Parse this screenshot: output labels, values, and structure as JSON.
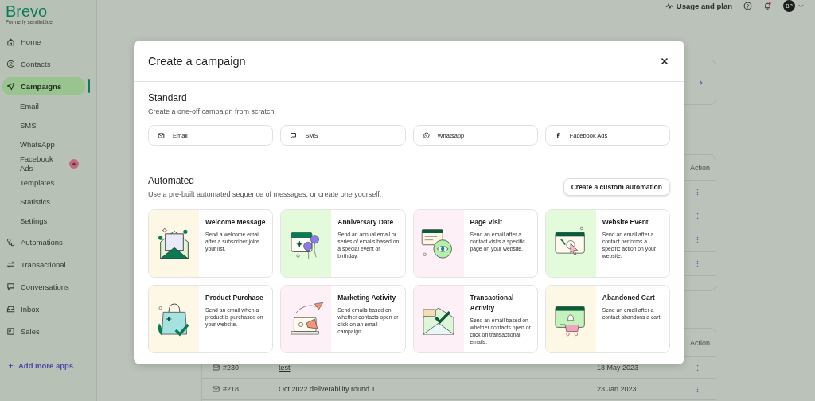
{
  "sidebar": {
    "logo": "Brevo",
    "logo_tagline": "Formerly sendinblue",
    "items": [
      {
        "label": "Home",
        "selected": false
      },
      {
        "label": "Contacts",
        "selected": false
      },
      {
        "label": "Campaigns",
        "selected": true,
        "children": [
          {
            "label": "Email",
            "upgrade_badge": false
          },
          {
            "label": "SMS",
            "upgrade_badge": false
          },
          {
            "label": "WhatsApp",
            "upgrade_badge": false
          },
          {
            "label": "Facebook Ads",
            "upgrade_badge": true
          },
          {
            "label": "Templates",
            "upgrade_badge": false
          },
          {
            "label": "Statistics",
            "upgrade_badge": false
          },
          {
            "label": "Settings",
            "upgrade_badge": false
          }
        ]
      },
      {
        "label": "Automations",
        "selected": false
      },
      {
        "label": "Transactional",
        "selected": false
      },
      {
        "label": "Conversations",
        "selected": false
      },
      {
        "label": "Inbox",
        "selected": false
      },
      {
        "label": "Sales",
        "selected": false
      }
    ],
    "add_apps": "Add more apps"
  },
  "header": {
    "usage_link": "Usage and plan",
    "notification_dot": true,
    "avatar_initials": "BP"
  },
  "tables": [
    {
      "action_header": "Action"
    },
    {
      "action_header": "Action",
      "rows": [
        {
          "id": "#230",
          "name": "test",
          "date": "18 May 2023"
        },
        {
          "id": "#218",
          "name": "Oct 2022 deliverability round 1",
          "date": "23 Jan 2023"
        }
      ]
    }
  ],
  "modal": {
    "title": "Create a campaign",
    "standard": {
      "heading": "Standard",
      "description": "Create a one-off campaign from scratch.",
      "channels": [
        {
          "label": "Email",
          "kind": "email"
        },
        {
          "label": "SMS",
          "kind": "sms"
        },
        {
          "label": "Whatsapp",
          "kind": "whatsapp"
        },
        {
          "label": "Facebook Ads",
          "kind": "facebook"
        }
      ]
    },
    "automated": {
      "heading": "Automated",
      "description": "Use a pre-built automated sequence of messages, or create one yourself.",
      "custom_button": "Create a custom automation",
      "templates": [
        {
          "title": "Welcome Message",
          "description": "Send a welcome email after a subscriber joins your list.",
          "kind": "welcome",
          "color": "#fdf8e6"
        },
        {
          "title": "Anniversary Date",
          "description": "Send an annual email or series of emails based on a special event or birthday.",
          "kind": "anniversary",
          "color": "#e3fadb"
        },
        {
          "title": "Page Visit",
          "description": "Send an email after a contact visits a specific page on your website.",
          "kind": "page_visit",
          "color": "#fdf0f6"
        },
        {
          "title": "Website Event",
          "description": "Send an email after a contact performs a specific action on your website.",
          "kind": "website_event",
          "color": "#e3fadb"
        },
        {
          "title": "Product Purchase",
          "description": "Send an email when a product is purchased on your website.",
          "kind": "purchase",
          "color": "#fdf8e6"
        },
        {
          "title": "Marketing Activity",
          "description": "Send emails based on whether contacts open or click on an email campaign.",
          "kind": "marketing",
          "color": "#fdf0f6"
        },
        {
          "title": "Transactional Activity",
          "description": "Send an email based on whether contacts open or click on transactional emails.",
          "kind": "transactional",
          "color": "#fdf0f6"
        },
        {
          "title": "Abandoned Cart",
          "description": "Send an email after a contact abandons a cart",
          "kind": "cart",
          "color": "#fdf8e6"
        }
      ]
    }
  }
}
